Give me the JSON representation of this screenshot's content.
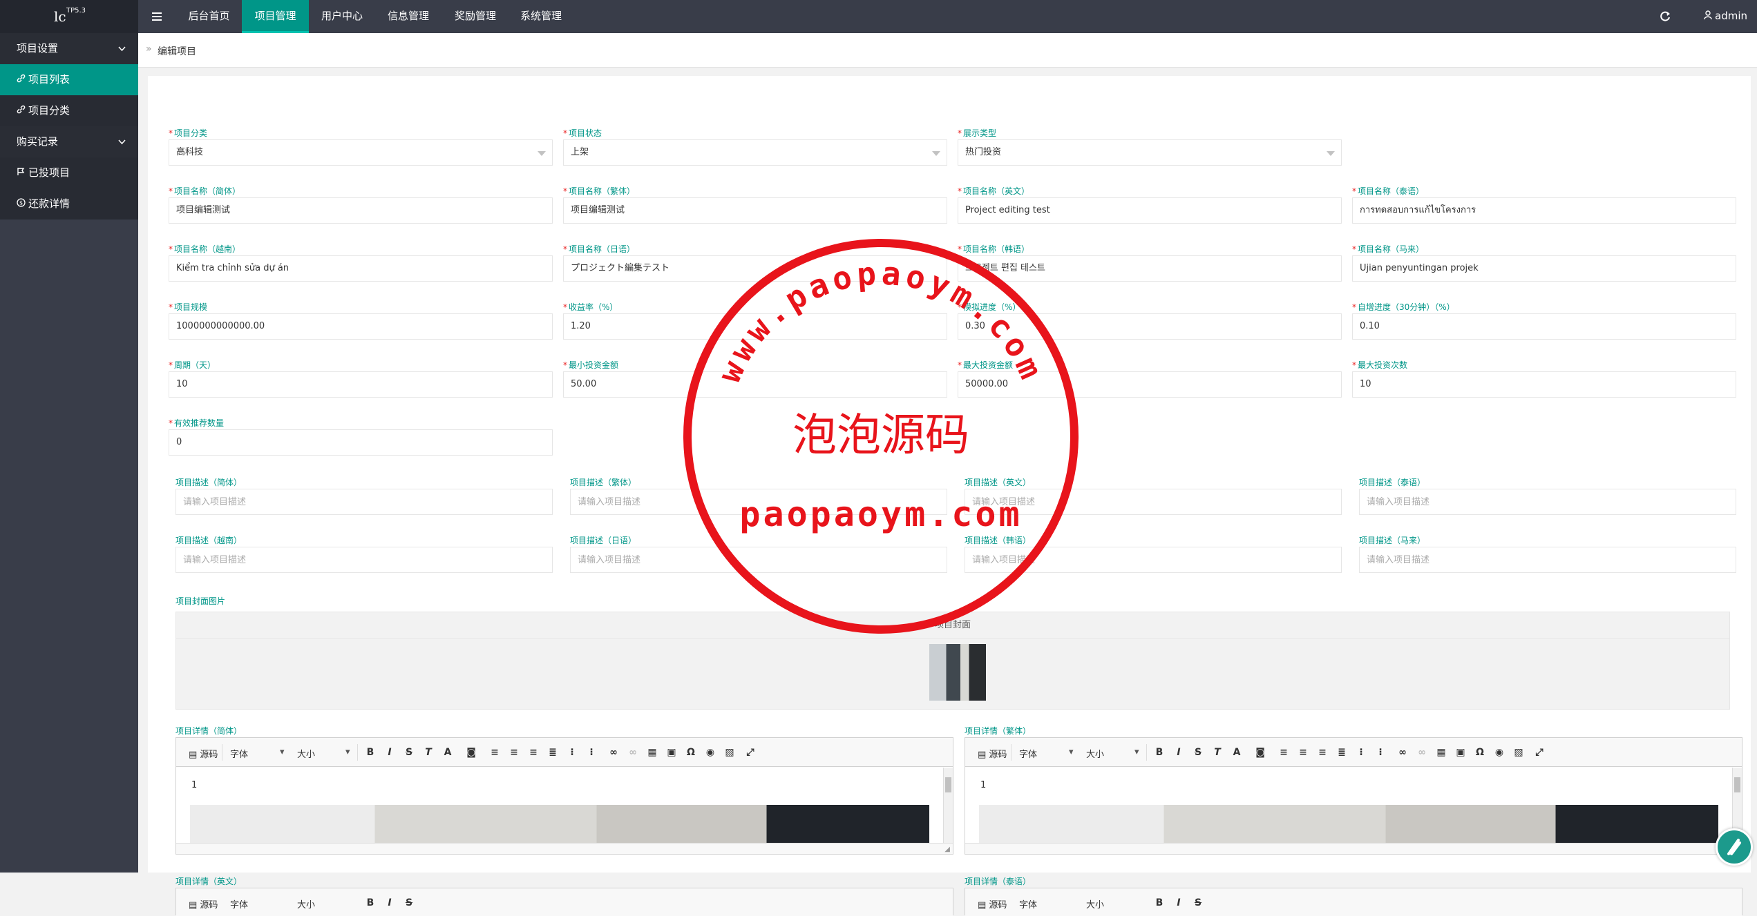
{
  "app": {
    "logo": "lc",
    "version": "TP5.3"
  },
  "nav": {
    "items": [
      "后台首页",
      "项目管理",
      "用户中心",
      "信息管理",
      "奖励管理",
      "系统管理"
    ],
    "active_index": 1
  },
  "user": {
    "name": "admin"
  },
  "sidebar": {
    "groups": [
      "项目设置",
      "购买记录"
    ],
    "items": [
      "项目列表",
      "项目分类",
      "已投项目",
      "还款详情"
    ],
    "active_index": 0
  },
  "breadcrumb": {
    "current": "编辑项目"
  },
  "form": {
    "category": {
      "label": "项目分类",
      "value": "高科技"
    },
    "status": {
      "label": "项目状态",
      "value": "上架"
    },
    "display_type": {
      "label": "展示类型",
      "value": "热门投资"
    },
    "name_cn": {
      "label": "项目名称（简体）",
      "value": "项目编辑测试"
    },
    "name_tw": {
      "label": "项目名称（繁体）",
      "value": "项目编辑测试"
    },
    "name_en": {
      "label": "项目名称（英文）",
      "value": "Project editing test"
    },
    "name_th": {
      "label": "项目名称（泰语）",
      "value": "การทดสอบการแก้ไขโครงการ"
    },
    "name_vi": {
      "label": "项目名称（越南）",
      "value": "Kiểm tra chỉnh sửa dự án"
    },
    "name_ja": {
      "label": "项目名称（日语）",
      "value": "プロジェクト編集テスト"
    },
    "name_ko": {
      "label": "项目名称（韩语）",
      "value": "프로젝트 편집 테스트"
    },
    "name_ms": {
      "label": "项目名称（马来）",
      "value": "Ujian penyuntingan projek"
    },
    "scale": {
      "label": "项目规模",
      "value": "1000000000000.00"
    },
    "rate": {
      "label": "收益率（%）",
      "value": "1.20"
    },
    "sim_progress": {
      "label": "模拟进度（%）",
      "value": "0.30"
    },
    "auto_progress": {
      "label": "自增进度（30分钟）（%）",
      "value": "0.10"
    },
    "period": {
      "label": "周期（天）",
      "value": "10"
    },
    "min_invest": {
      "label": "最小投资金额",
      "value": "50.00"
    },
    "max_invest": {
      "label": "最大投资金额",
      "value": "50000.00"
    },
    "max_times": {
      "label": "最大投资次数",
      "value": "10"
    },
    "recommend": {
      "label": "有效推荐数量",
      "value": "0"
    },
    "desc_placeholder": "请输入项目描述",
    "desc_labels": [
      "项目描述（简体）",
      "项目描述（繁体）",
      "项目描述（英文）",
      "项目描述（泰语）",
      "项目描述（越南）",
      "项目描述（日语）",
      "项目描述（韩语）",
      "项目描述（马来）"
    ],
    "cover": {
      "label": "项目封面图片",
      "header": "项目封面"
    },
    "detail_labels": [
      "项目详情（简体）",
      "项目详情（繁体）",
      "项目详情（英文）",
      "项目详情（泰语）"
    ]
  },
  "editor": {
    "source": "源码",
    "font": "字体",
    "size": "大小",
    "content_line": "1"
  },
  "watermark": {
    "url": "www.paopaoym.com",
    "title": "泡泡源码",
    "domain": "paopaoym.com"
  },
  "colors": {
    "accent": "#009688",
    "topbar": "#393d49",
    "required": "#e81e1e",
    "seal": "#e8141b"
  }
}
